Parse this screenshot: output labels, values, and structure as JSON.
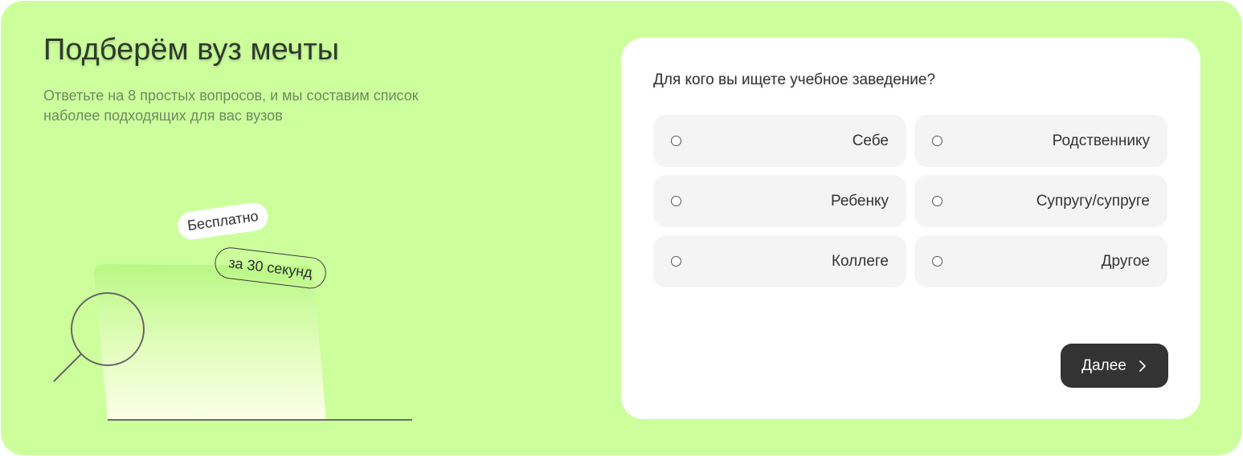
{
  "header": {
    "title": "Подберём вуз мечты",
    "subtitle": "Ответьте на 8 простых вопросов, и мы составим список наболее подходящих для вас вузов"
  },
  "illustration": {
    "badge_free": "Бесплатно",
    "badge_time": "за 30 секунд",
    "icon": "magnifier-icon"
  },
  "quiz": {
    "question": "Для кого вы ищете учебное заведение?",
    "options": [
      {
        "label": "Себе"
      },
      {
        "label": "Родственнику"
      },
      {
        "label": "Ребенку"
      },
      {
        "label": "Супругу/супруге"
      },
      {
        "label": "Коллеге"
      },
      {
        "label": "Другое"
      }
    ],
    "next_label": "Далее",
    "next_icon": "chevron-right-icon"
  },
  "colors": {
    "background": "#ccff9c",
    "card": "#ffffff",
    "option_bg": "#f4f4f4",
    "button_bg": "#333333"
  }
}
